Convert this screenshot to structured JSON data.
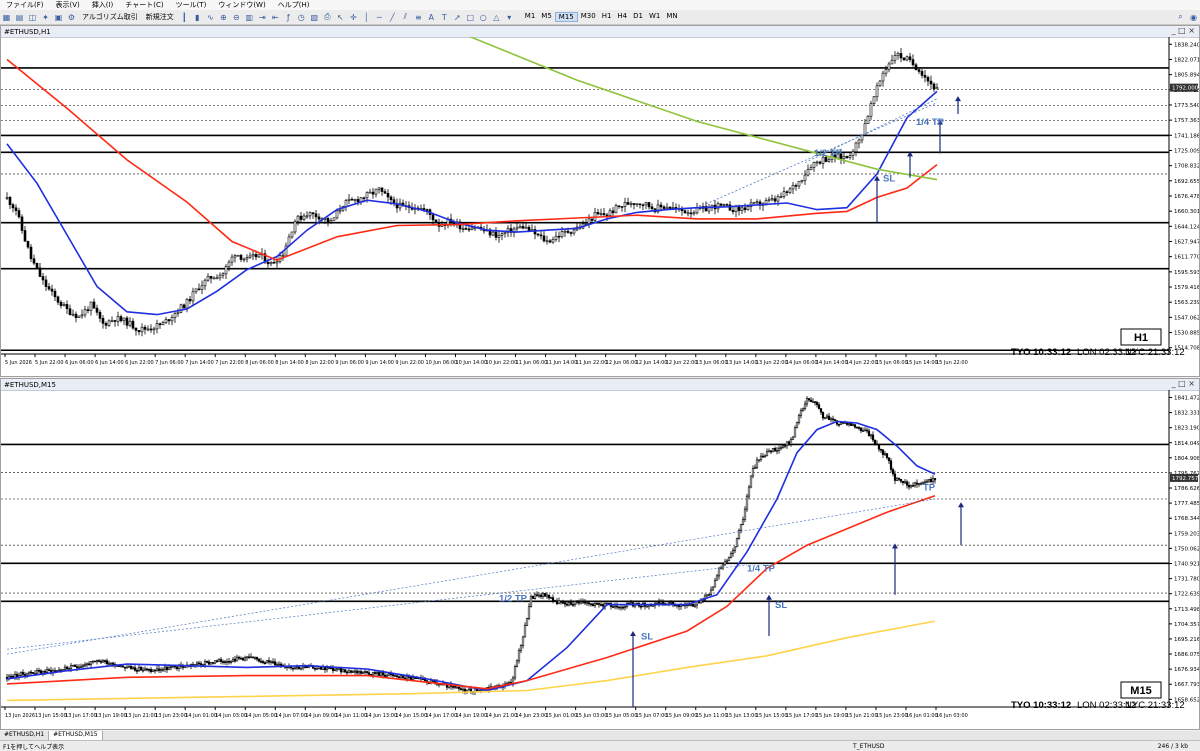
{
  "menu": [
    "ファイル(F)",
    "表示(V)",
    "挿入(I)",
    "チャート(C)",
    "ツール(T)",
    "ウィンドウ(W)",
    "ヘルプ(H)"
  ],
  "toolbar": {
    "algo_label": "アルゴリズム取引",
    "new_order_label": "新規注文",
    "timeframes": [
      "M1",
      "M5",
      "M15",
      "M30",
      "H1",
      "H4",
      "D1",
      "W1",
      "MN"
    ],
    "active_timeframe": "M15"
  },
  "windows": {
    "h1": {
      "title": "#ETHUSD,H1",
      "period_badge": "H1",
      "price_label": "1792.000"
    },
    "m15": {
      "title": "#ETHUSD,M15",
      "period_badge": "M15",
      "price_label": "1792.757"
    }
  },
  "clock": {
    "tyo": "TYO 10:33:12",
    "lon": "LON 02:33:12",
    "nyc": "NYC 21:33:12"
  },
  "tabs": [
    "#ETHUSD,H1",
    "#ETHUSD,M15"
  ],
  "status": {
    "help": "F1を押してヘルプ表示",
    "symbol": "T_ETHUSD",
    "traffic": "246 / 3 kb"
  },
  "chart_data": [
    {
      "type": "candlestick",
      "symbol": "#ETHUSD",
      "timeframe": "H1",
      "x_tick_labels": [
        "5 Jun 2026",
        "5 Jun 22:00",
        "6 Jun 06:00",
        "6 Jun 14:00",
        "6 Jun 22:00",
        "7 Jun 06:00",
        "7 Jun 14:00",
        "7 Jun 22:00",
        "8 Jun 06:00",
        "8 Jun 14:00",
        "8 Jun 22:00",
        "9 Jun 06:00",
        "9 Jun 14:00",
        "9 Jun 22:00",
        "10 Jun 06:00",
        "10 Jun 14:00",
        "10 Jun 22:00",
        "11 Jun 06:00",
        "11 Jun 14:00",
        "11 Jun 22:00",
        "12 Jun 06:00",
        "12 Jun 14:00",
        "12 Jun 22:00",
        "13 Jun 06:00",
        "13 Jun 14:00",
        "13 Jun 22:00",
        "14 Jun 06:00",
        "14 Jun 14:00",
        "14 Jun 22:00",
        "15 Jun 06:00",
        "15 Jun 14:00",
        "15 Jun 22:00"
      ],
      "y_tick_labels": [
        "1838.240",
        "1822.071",
        "1805.894",
        "1789.718",
        "1773.540",
        "1757.363",
        "1741.186",
        "1725.009",
        "1708.832",
        "1692.655",
        "1676.478",
        "1660.301",
        "1644.124",
        "1627.947",
        "1611.770",
        "1595.593",
        "1579.416",
        "1563.239",
        "1547.062",
        "1530.885",
        "1514.708"
      ],
      "ylim": [
        1508,
        1846
      ],
      "price_series": [
        [
          0,
          1674
        ],
        [
          3,
          1662
        ],
        [
          5,
          1640
        ],
        [
          8,
          1610
        ],
        [
          12,
          1585
        ],
        [
          16,
          1568
        ],
        [
          20,
          1555
        ],
        [
          24,
          1548
        ],
        [
          28,
          1560
        ],
        [
          32,
          1540
        ],
        [
          36,
          1546
        ],
        [
          40,
          1542
        ],
        [
          44,
          1534
        ],
        [
          48,
          1536
        ],
        [
          52,
          1540
        ],
        [
          56,
          1552
        ],
        [
          60,
          1563
        ],
        [
          64,
          1580
        ],
        [
          68,
          1590
        ],
        [
          72,
          1594
        ],
        [
          76,
          1616
        ],
        [
          80,
          1608
        ],
        [
          84,
          1614
        ],
        [
          88,
          1604
        ],
        [
          92,
          1616
        ],
        [
          96,
          1650
        ],
        [
          100,
          1658
        ],
        [
          104,
          1655
        ],
        [
          108,
          1648
        ],
        [
          112,
          1668
        ],
        [
          116,
          1672
        ],
        [
          120,
          1677
        ],
        [
          124,
          1683
        ],
        [
          128,
          1670
        ],
        [
          132,
          1664
        ],
        [
          136,
          1666
        ],
        [
          140,
          1660
        ],
        [
          144,
          1646
        ],
        [
          148,
          1650
        ],
        [
          152,
          1643
        ],
        [
          156,
          1644
        ],
        [
          160,
          1638
        ],
        [
          164,
          1634
        ],
        [
          168,
          1640
        ],
        [
          172,
          1644
        ],
        [
          176,
          1636
        ],
        [
          180,
          1628
        ],
        [
          184,
          1635
        ],
        [
          188,
          1640
        ],
        [
          192,
          1645
        ],
        [
          196,
          1656
        ],
        [
          200,
          1657
        ],
        [
          204,
          1665
        ],
        [
          208,
          1670
        ],
        [
          212,
          1669
        ],
        [
          216,
          1663
        ],
        [
          220,
          1666
        ],
        [
          224,
          1661
        ],
        [
          228,
          1660
        ],
        [
          232,
          1662
        ],
        [
          236,
          1666
        ],
        [
          240,
          1664
        ],
        [
          244,
          1662
        ],
        [
          248,
          1666
        ],
        [
          252,
          1669
        ],
        [
          256,
          1672
        ],
        [
          260,
          1680
        ],
        [
          264,
          1692
        ],
        [
          268,
          1710
        ],
        [
          272,
          1716
        ],
        [
          276,
          1718
        ],
        [
          280,
          1718
        ],
        [
          284,
          1735
        ],
        [
          288,
          1773
        ],
        [
          292,
          1808
        ],
        [
          296,
          1828
        ],
        [
          300,
          1822
        ],
        [
          304,
          1812
        ],
        [
          308,
          1796
        ],
        [
          310,
          1790
        ]
      ],
      "ma_series": [
        {
          "name": "MA blue",
          "color": "#1f2ee0",
          "points": [
            [
              0,
              1732
            ],
            [
              10,
              1690
            ],
            [
              20,
              1635
            ],
            [
              30,
              1580
            ],
            [
              40,
              1553
            ],
            [
              50,
              1550
            ],
            [
              60,
              1556
            ],
            [
              70,
              1575
            ],
            [
              80,
              1598
            ],
            [
              90,
              1612
            ],
            [
              100,
              1640
            ],
            [
              110,
              1662
            ],
            [
              120,
              1672
            ],
            [
              130,
              1668
            ],
            [
              140,
              1660
            ],
            [
              150,
              1648
            ],
            [
              160,
              1640
            ],
            [
              170,
              1638
            ],
            [
              180,
              1640
            ],
            [
              190,
              1642
            ],
            [
              200,
              1652
            ],
            [
              210,
              1659
            ],
            [
              220,
              1662
            ],
            [
              230,
              1664
            ],
            [
              240,
              1665
            ],
            [
              250,
              1667
            ],
            [
              260,
              1669
            ],
            [
              270,
              1662
            ],
            [
              280,
              1664
            ],
            [
              290,
              1700
            ],
            [
              300,
              1760
            ],
            [
              310,
              1788
            ]
          ]
        },
        {
          "name": "MA red",
          "color": "#ff2a14",
          "points": [
            [
              0,
              1822
            ],
            [
              20,
              1770
            ],
            [
              40,
              1715
            ],
            [
              60,
              1670
            ],
            [
              75,
              1628
            ],
            [
              90,
              1608
            ],
            [
              110,
              1633
            ],
            [
              130,
              1645
            ],
            [
              150,
              1646
            ],
            [
              170,
              1650
            ],
            [
              190,
              1653
            ],
            [
              210,
              1656
            ],
            [
              230,
              1652
            ],
            [
              250,
              1652
            ],
            [
              270,
              1658
            ],
            [
              280,
              1660
            ],
            [
              290,
              1675
            ],
            [
              300,
              1685
            ],
            [
              310,
              1710
            ]
          ]
        },
        {
          "name": "MA green",
          "color": "#8cc43c",
          "points": [
            [
              115,
              1918
            ],
            [
              150,
              1852
            ],
            [
              190,
              1800
            ],
            [
              230,
              1756
            ],
            [
              270,
              1722
            ],
            [
              290,
              1705
            ],
            [
              310,
              1694
            ]
          ]
        }
      ],
      "horizontal_levels_solid": [
        1813,
        1741,
        1723,
        1648,
        1599,
        1512
      ],
      "horizontal_levels_dotted": [
        1790,
        1773,
        1757,
        1700
      ],
      "annotations": [
        "1/2 TP",
        "1/4 TP",
        "SL"
      ]
    },
    {
      "type": "candlestick",
      "symbol": "#ETHUSD",
      "timeframe": "M15",
      "x_tick_labels": [
        "13 Jun 2026",
        "13 Jun 15:00",
        "13 Jun 17:00",
        "13 Jun 19:00",
        "13 Jun 21:00",
        "13 Jun 23:00",
        "14 Jun 01:00",
        "14 Jun 03:00",
        "14 Jun 05:00",
        "14 Jun 07:00",
        "14 Jun 09:00",
        "14 Jun 11:00",
        "14 Jun 13:00",
        "14 Jun 15:00",
        "14 Jun 17:00",
        "14 Jun 19:00",
        "14 Jun 21:00",
        "14 Jun 23:00",
        "15 Jun 01:00",
        "15 Jun 03:00",
        "15 Jun 05:00",
        "15 Jun 07:00",
        "15 Jun 09:00",
        "15 Jun 11:00",
        "15 Jun 13:00",
        "15 Jun 15:00",
        "15 Jun 17:00",
        "15 Jun 19:00",
        "15 Jun 21:00",
        "15 Jun 23:00",
        "16 Jun 01:00",
        "16 Jun 03:00"
      ],
      "y_tick_labels": [
        "1841.472",
        "1832.331",
        "1823.190",
        "1814.049",
        "1804.908",
        "1795.767",
        "1786.626",
        "1777.485",
        "1768.344",
        "1759.203",
        "1750.062",
        "1740.921",
        "1731.780",
        "1722.639",
        "1713.498",
        "1704.357",
        "1695.216",
        "1686.075",
        "1676.934",
        "1667.793",
        "1658.652"
      ],
      "ylim": [
        1654,
        1846
      ],
      "price_series": [
        [
          0,
          1672
        ],
        [
          12,
          1675
        ],
        [
          24,
          1676
        ],
        [
          36,
          1679
        ],
        [
          48,
          1682
        ],
        [
          60,
          1678
        ],
        [
          72,
          1676
        ],
        [
          84,
          1678
        ],
        [
          96,
          1680
        ],
        [
          108,
          1682
        ],
        [
          120,
          1684
        ],
        [
          132,
          1681
        ],
        [
          144,
          1678
        ],
        [
          156,
          1678
        ],
        [
          168,
          1676
        ],
        [
          180,
          1675
        ],
        [
          192,
          1673
        ],
        [
          204,
          1671
        ],
        [
          216,
          1668
        ],
        [
          228,
          1664
        ],
        [
          240,
          1665
        ],
        [
          252,
          1668
        ],
        [
          258,
          1697
        ],
        [
          262,
          1720
        ],
        [
          266,
          1722
        ],
        [
          270,
          1722
        ],
        [
          274,
          1718
        ],
        [
          280,
          1716
        ],
        [
          286,
          1718
        ],
        [
          292,
          1716
        ],
        [
          298,
          1716
        ],
        [
          304,
          1715
        ],
        [
          310,
          1716
        ],
        [
          316,
          1716
        ],
        [
          322,
          1716
        ],
        [
          328,
          1717
        ],
        [
          334,
          1716
        ],
        [
          340,
          1716
        ],
        [
          344,
          1716
        ],
        [
          348,
          1720
        ],
        [
          352,
          1724
        ],
        [
          356,
          1738
        ],
        [
          360,
          1742
        ],
        [
          364,
          1752
        ],
        [
          368,
          1768
        ],
        [
          372,
          1795
        ],
        [
          376,
          1805
        ],
        [
          380,
          1808
        ],
        [
          384,
          1810
        ],
        [
          388,
          1812
        ],
        [
          392,
          1815
        ],
        [
          396,
          1830
        ],
        [
          400,
          1840
        ],
        [
          404,
          1838
        ],
        [
          408,
          1830
        ],
        [
          412,
          1828
        ],
        [
          416,
          1826
        ],
        [
          420,
          1826
        ],
        [
          424,
          1824
        ],
        [
          428,
          1822
        ],
        [
          432,
          1818
        ],
        [
          436,
          1810
        ],
        [
          440,
          1806
        ],
        [
          444,
          1792
        ],
        [
          448,
          1790
        ],
        [
          452,
          1788
        ],
        [
          456,
          1790
        ],
        [
          460,
          1792
        ],
        [
          464,
          1791
        ]
      ],
      "ma_series": [
        {
          "name": "MA blue",
          "color": "#1f2ee0",
          "points": [
            [
              0,
              1671
            ],
            [
              30,
              1676
            ],
            [
              60,
              1680
            ],
            [
              90,
              1679
            ],
            [
              120,
              1678
            ],
            [
              150,
              1679
            ],
            [
              180,
              1677
            ],
            [
              210,
              1671
            ],
            [
              240,
              1664
            ],
            [
              260,
              1670
            ],
            [
              280,
              1690
            ],
            [
              300,
              1716
            ],
            [
              320,
              1716
            ],
            [
              340,
              1716
            ],
            [
              355,
              1722
            ],
            [
              370,
              1748
            ],
            [
              385,
              1780
            ],
            [
              395,
              1808
            ],
            [
              405,
              1822
            ],
            [
              415,
              1827
            ],
            [
              425,
              1826
            ],
            [
              435,
              1822
            ],
            [
              445,
              1812
            ],
            [
              455,
              1800
            ],
            [
              464,
              1795
            ]
          ]
        },
        {
          "name": "MA red",
          "color": "#ff2a14",
          "points": [
            [
              0,
              1668
            ],
            [
              60,
              1672
            ],
            [
              120,
              1673
            ],
            [
              180,
              1673
            ],
            [
              240,
              1665
            ],
            [
              260,
              1670
            ],
            [
              300,
              1684
            ],
            [
              340,
              1700
            ],
            [
              360,
              1715
            ],
            [
              380,
              1738
            ],
            [
              400,
              1752
            ],
            [
              420,
              1762
            ],
            [
              440,
              1772
            ],
            [
              464,
              1782
            ]
          ]
        },
        {
          "name": "MA yellow",
          "color": "#ffd34a",
          "points": [
            [
              0,
              1658
            ],
            [
              100,
              1660
            ],
            [
              200,
              1662
            ],
            [
              260,
              1664
            ],
            [
              300,
              1670
            ],
            [
              340,
              1678
            ],
            [
              380,
              1685
            ],
            [
              420,
              1696
            ],
            [
              464,
              1706
            ]
          ]
        }
      ],
      "horizontal_levels_solid": [
        1813,
        1741,
        1718
      ],
      "horizontal_levels_dotted": [
        1796,
        1780,
        1752,
        1723
      ],
      "annotations": [
        "1/2 TP",
        "1/4 TP",
        "TP",
        "SL"
      ]
    }
  ]
}
